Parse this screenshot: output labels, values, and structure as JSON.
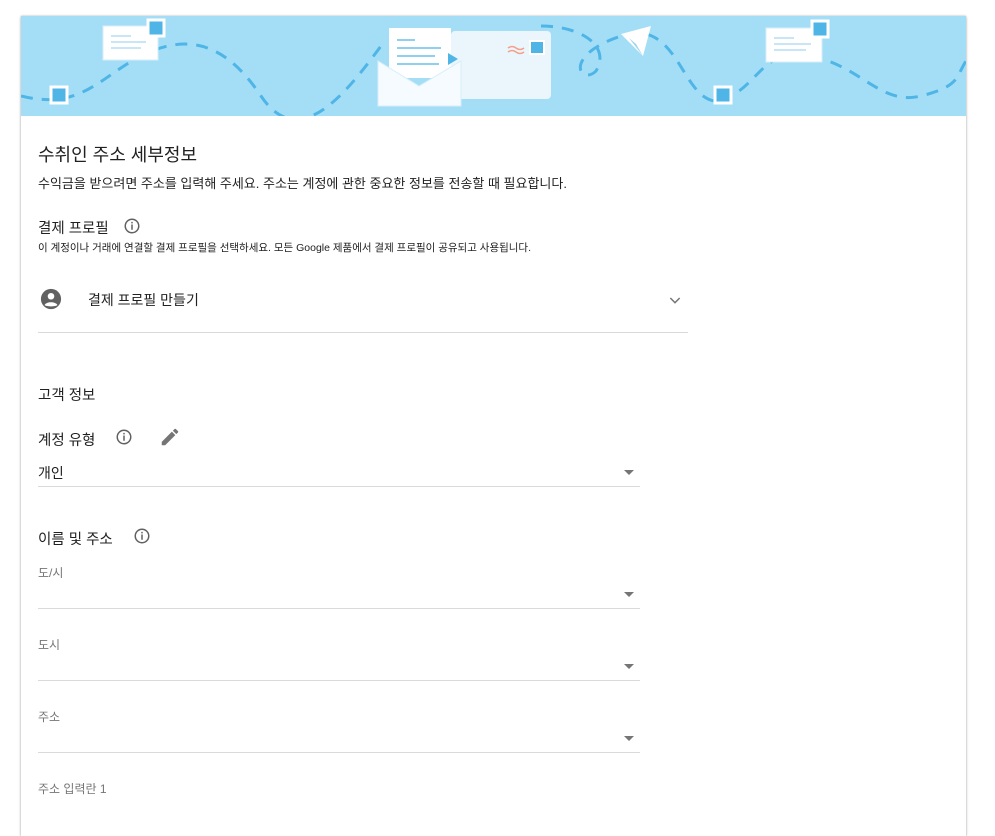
{
  "section_title": "수취인 주소 세부정보",
  "section_desc": "수익금을 받으려면 주소를 입력해 주세요. 주소는 계정에 관한 중요한 정보를 전송할 때 필요합니다.",
  "payment_profile": {
    "label": "결제 프로필",
    "desc": "이 계정이나 거래에 연결할 결제 프로필을 선택하세요. 모든 Google 제품에서 결제 프로필이 공유되고 사용됩니다.",
    "selected": "결제 프로필 만들기"
  },
  "customer_info": {
    "title": "고객 정보",
    "account_type_label": "계정 유형",
    "account_type_value": "개인"
  },
  "name_address": {
    "title": "이름 및 주소",
    "fields": [
      {
        "label": "도/시",
        "value": ""
      },
      {
        "label": "도시",
        "value": ""
      },
      {
        "label": "주소",
        "value": ""
      },
      {
        "label": "주소 입력란 1",
        "value": ""
      }
    ]
  },
  "colors": {
    "banner_bg": "#a4def6",
    "accent_blue": "#4fb5e6",
    "text": "#212121",
    "muted": "#757575",
    "divider": "#dadada"
  },
  "icons": [
    "envelope-icon",
    "paper-plane-icon",
    "info-icon",
    "account-circle-icon",
    "chevron-down-icon",
    "pencil-icon",
    "dropdown-caret-icon"
  ]
}
